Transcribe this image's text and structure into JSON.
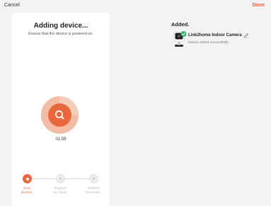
{
  "header": {
    "cancel_label": "Cancel",
    "done_label": "Done"
  },
  "progress_card": {
    "title": "Adding device...",
    "subtitle": "Ensure that the device is powered on.",
    "timer": "01:58",
    "scan_icon": "search-icon",
    "steps": [
      {
        "label_line1": "Scan",
        "label_line2": "devices.",
        "state": "active"
      },
      {
        "label_line1": "Register",
        "label_line2": "on Cloud.",
        "state": "pending"
      },
      {
        "label_line1": "Initialize",
        "label_line2": "the device.",
        "state": "pending"
      }
    ]
  },
  "result": {
    "title": "Added.",
    "device_name": "Link2home Indoor Camera",
    "device_status": "Device added successfully",
    "device_icon": "camera-icon",
    "edit_icon": "pencil-icon"
  },
  "colors": {
    "accent": "#e9673c",
    "accent_light": "#f2bca5",
    "success": "#3cb371",
    "background": "#f3f3f3"
  }
}
